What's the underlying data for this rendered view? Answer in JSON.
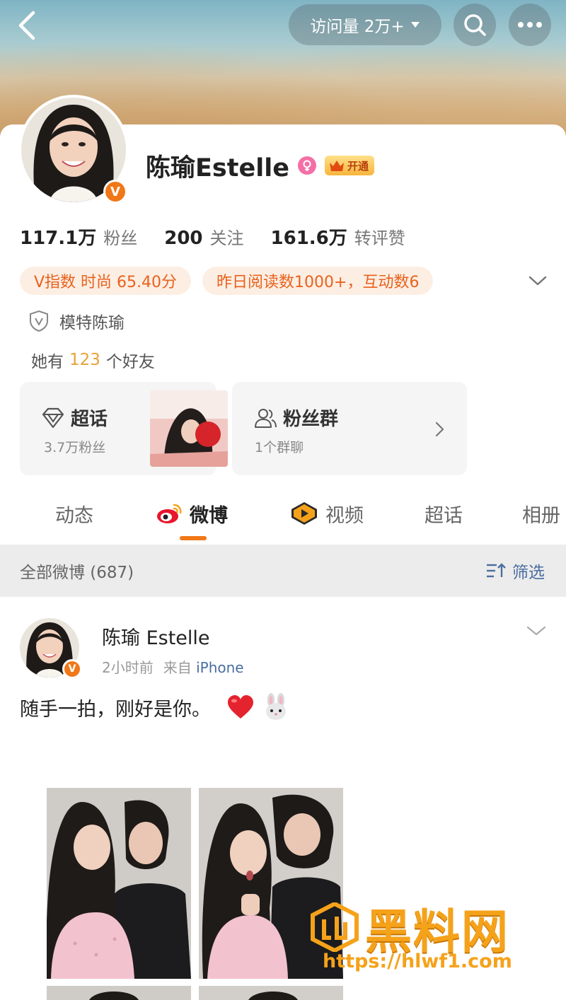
{
  "header": {
    "visits_label": "访问量 2万+"
  },
  "profile": {
    "name": "陈瑜Estelle",
    "vip_label": "开通",
    "stats": [
      {
        "value": "117.1万",
        "label": "粉丝"
      },
      {
        "value": "200",
        "label": "关注"
      },
      {
        "value": "161.6万",
        "label": "转评赞"
      }
    ],
    "tags": [
      "V指数 时尚 65.40分",
      "昨日阅读数1000+，互动数6"
    ],
    "verification": "模特陈瑜",
    "friends_prefix": "她有",
    "friends_count": "123",
    "friends_suffix": "个好友",
    "supertopic": {
      "title": "超话",
      "subtitle": "3.7万粉丝"
    },
    "fan_group": {
      "title": "粉丝群",
      "subtitle": "1个群聊"
    },
    "badge_letter": "V"
  },
  "tabs": [
    {
      "label": "动态"
    },
    {
      "label": "微博"
    },
    {
      "label": "视频"
    },
    {
      "label": "超话"
    },
    {
      "label": "相册"
    }
  ],
  "filter": {
    "count_label": "全部微博 (687)",
    "filter_label": "筛选"
  },
  "post": {
    "author": "陈瑜 Estelle",
    "time": "2小时前",
    "source_prefix": "来自",
    "source": "iPhone",
    "text": "随手一拍，刚好是你。"
  },
  "watermark": {
    "title": "黑料网",
    "url": "https://hlwf1.com"
  },
  "colors": {
    "accent": "#f07818",
    "tag_bg": "#fdeee3",
    "tag_text": "#e8621d",
    "link": "#4a6ea0",
    "watermark": "#f5a21b"
  }
}
